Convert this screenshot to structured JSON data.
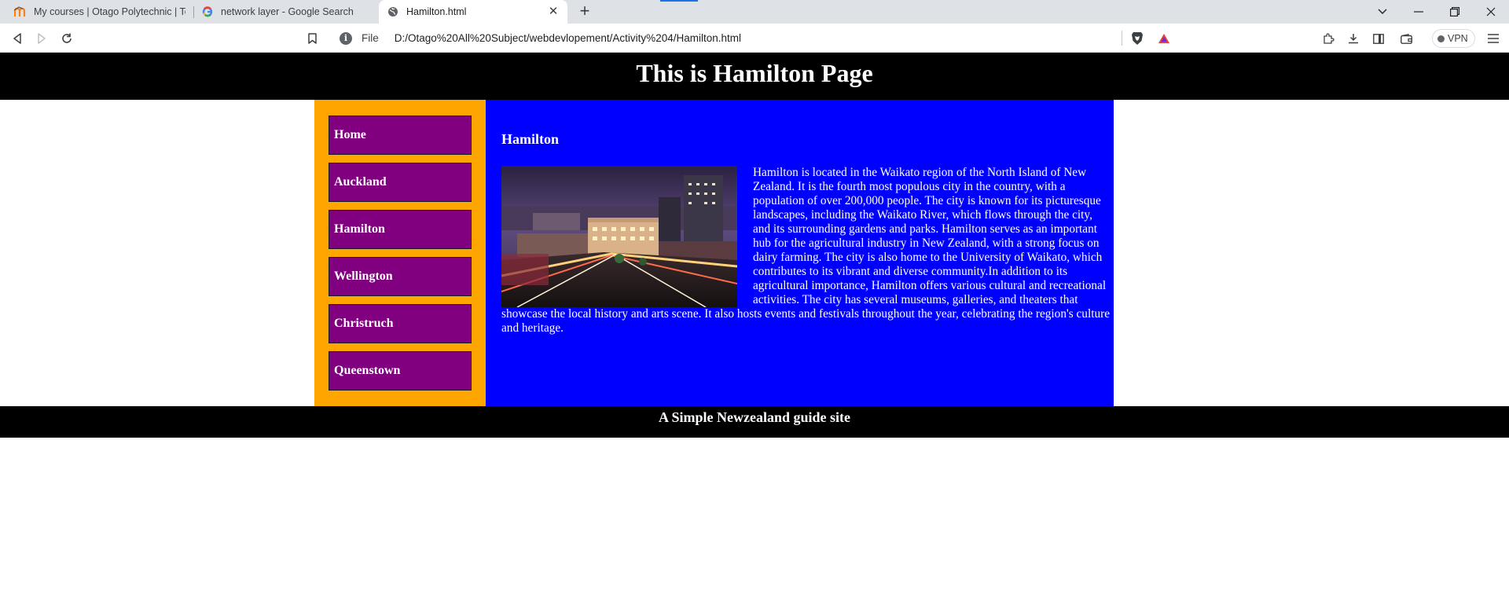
{
  "browser": {
    "tabs": [
      {
        "title": "My courses | Otago Polytechnic | Te P",
        "favicon": "moodle-icon",
        "active": false
      },
      {
        "title": "network layer - Google Search",
        "favicon": "google-icon",
        "active": false
      },
      {
        "title": "Hamilton.html",
        "favicon": "globe-icon",
        "active": true
      }
    ],
    "address": {
      "scheme": "File",
      "url": "D:/Otago%20All%20Subject/webdevlopement/Activity%204/Hamilton.html"
    },
    "vpn_label": "VPN"
  },
  "page": {
    "header_title": "This is Hamilton Page",
    "nav": [
      {
        "label": "Home"
      },
      {
        "label": "Auckland"
      },
      {
        "label": "Hamilton"
      },
      {
        "label": "Wellington"
      },
      {
        "label": "Christruch"
      },
      {
        "label": "Queenstown"
      }
    ],
    "main": {
      "heading": "Hamilton",
      "paragraph": "Hamilton is located in the Waikato region of the North Island of New Zealand. It is the fourth most populous city in the country, with a population of over 200,000 people. The city is known for its picturesque landscapes, including the Waikato River, which flows through the city, and its surrounding gardens and parks. Hamilton serves as an important hub for the agricultural industry in New Zealand, with a strong focus on dairy farming. The city is also home to the University of Waikato, which contributes to its vibrant and diverse community.In addition to its agricultural importance, Hamilton offers various cultural and recreational activities. The city has several museums, galleries, and theaters that showcase the local history and arts scene. It also hosts events and festivals throughout the year, celebrating the region's culture and heritage."
    },
    "footer_text": "A Simple Newzealand guide site"
  },
  "colors": {
    "header_bg": "#000000",
    "sidebar_bg": "#ffa500",
    "nav_bg": "#800080",
    "main_bg": "#0000ff",
    "footer_bg": "#000000"
  }
}
